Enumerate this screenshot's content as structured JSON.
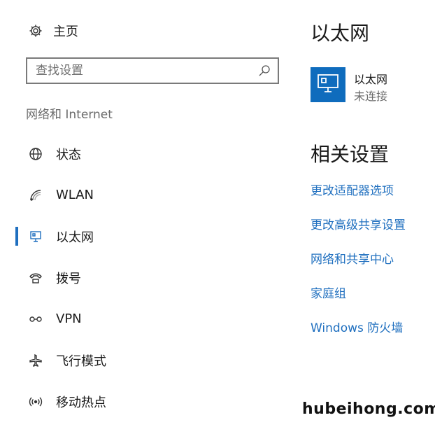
{
  "home": {
    "label": "主页",
    "icon": "gear-icon"
  },
  "search": {
    "placeholder": "查找设置",
    "icon": "search-icon"
  },
  "section_title": "网络和 Internet",
  "nav": [
    {
      "label": "状态",
      "icon": "globe-icon",
      "active": false
    },
    {
      "label": "WLAN",
      "icon": "wifi-icon",
      "active": false
    },
    {
      "label": "以太网",
      "icon": "ethernet-icon",
      "active": true
    },
    {
      "label": "拨号",
      "icon": "dialup-icon",
      "active": false
    },
    {
      "label": "VPN",
      "icon": "vpn-icon",
      "active": false
    },
    {
      "label": "飞行模式",
      "icon": "airplane-icon",
      "active": false
    },
    {
      "label": "移动热点",
      "icon": "hotspot-icon",
      "active": false
    }
  ],
  "main": {
    "title": "以太网",
    "ethernet": {
      "name": "以太网",
      "status": "未连接",
      "icon": "ethernet-monitor-icon"
    },
    "related_title": "相关设置",
    "links": [
      "更改适配器选项",
      "更改高级共享设置",
      "网络和共享中心",
      "家庭组",
      "Windows 防火墙"
    ]
  },
  "watermark": "hubeihong.com",
  "colors": {
    "accent": "#1f6fbf",
    "tile": "#0f6cbd",
    "text": "#1a1a1a",
    "muted": "#6b6b6b"
  }
}
